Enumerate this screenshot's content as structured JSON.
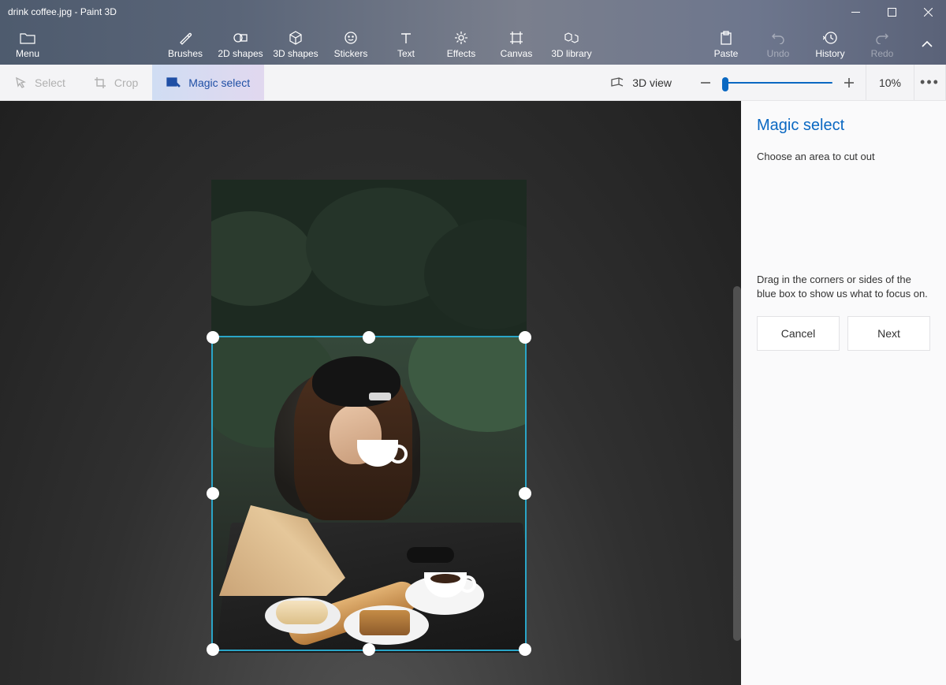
{
  "title": "drink coffee.jpg - Paint 3D",
  "ribbon": {
    "menu": "Menu",
    "tools": [
      {
        "id": "brushes",
        "label": "Brushes"
      },
      {
        "id": "shapes2d",
        "label": "2D shapes"
      },
      {
        "id": "shapes3d",
        "label": "3D shapes"
      },
      {
        "id": "stickers",
        "label": "Stickers"
      },
      {
        "id": "text",
        "label": "Text"
      },
      {
        "id": "effects",
        "label": "Effects"
      },
      {
        "id": "canvas",
        "label": "Canvas"
      },
      {
        "id": "lib3d",
        "label": "3D library"
      }
    ],
    "right": [
      {
        "id": "paste",
        "label": "Paste",
        "disabled": false
      },
      {
        "id": "undo",
        "label": "Undo",
        "disabled": true
      },
      {
        "id": "history",
        "label": "History",
        "disabled": false
      },
      {
        "id": "redo",
        "label": "Redo",
        "disabled": true
      }
    ]
  },
  "toolbar": {
    "select": "Select",
    "crop": "Crop",
    "magic": "Magic select",
    "view3d": "3D view",
    "zoom": "10%"
  },
  "panel": {
    "title": "Magic select",
    "subtitle": "Choose an area to cut out",
    "hint": "Drag in the corners or sides of the blue box to show us what to focus on.",
    "cancel": "Cancel",
    "next": "Next"
  }
}
